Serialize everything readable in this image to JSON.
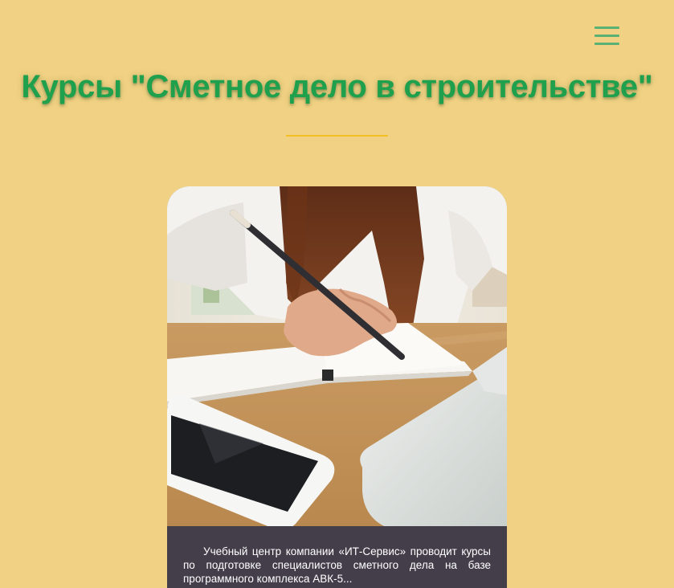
{
  "header": {
    "menu_icon": "hamburger-menu-icon",
    "title": "Курсы \"Сметное дело в строительстве\"",
    "accent_color": "#1ea04d",
    "divider_color": "#f4bf22"
  },
  "card": {
    "image_alt": "",
    "text": "Учебный центр компании «ИТ-Сервис» проводит курсы по подготовке специалистов сметного дела на базе программного комплекса АВК-5..."
  },
  "page": {
    "background_color": "#f1d183",
    "card_text_background": "#443e4b"
  }
}
